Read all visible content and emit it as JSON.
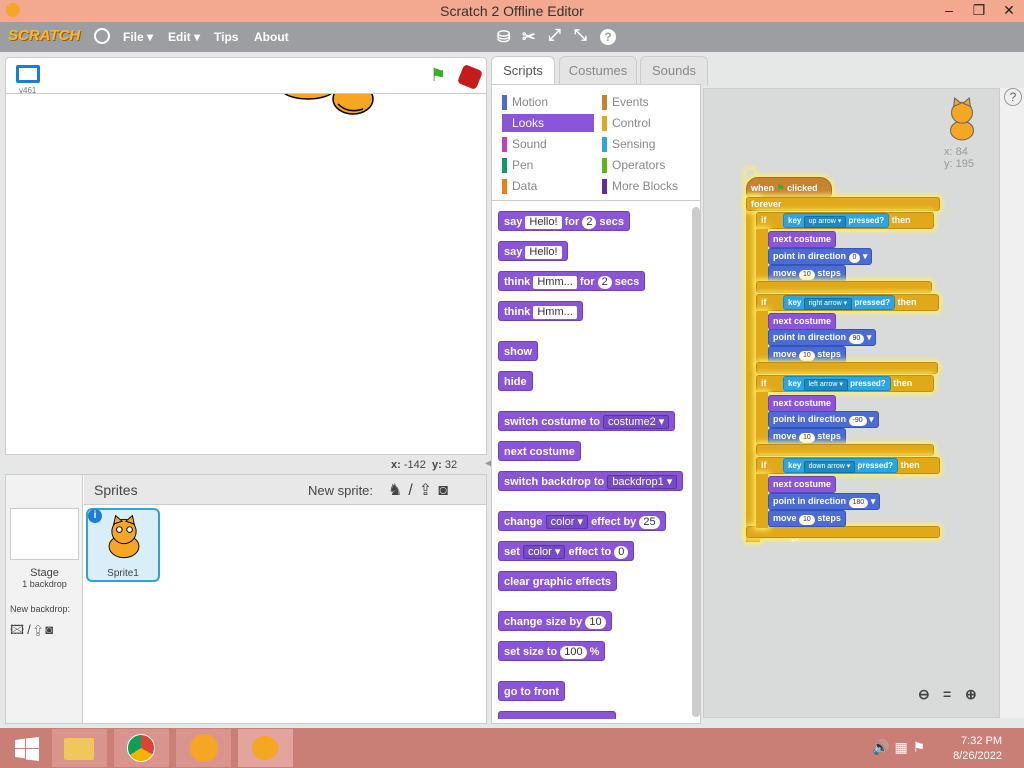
{
  "window": {
    "title": "Scratch 2 Offline Editor"
  },
  "menu": {
    "logo": "SCRATCH",
    "file": "File ▾",
    "edit": "Edit ▾",
    "tips": "Tips",
    "about": "About"
  },
  "stage": {
    "version": "v461",
    "mouse_x_label": "x:",
    "mouse_x": "-142",
    "mouse_y_label": "y:",
    "mouse_y": "32"
  },
  "sprites_pane": {
    "title": "Sprites",
    "new_sprite": "New sprite:",
    "stage_label": "Stage",
    "stage_backdrops": "1 backdrop",
    "new_backdrop": "New backdrop:",
    "sprite_name": "Sprite1"
  },
  "tabs": [
    "Scripts",
    "Costumes",
    "Sounds"
  ],
  "categories": [
    {
      "label": "Motion",
      "color": "#4a6cd4"
    },
    {
      "label": "Events",
      "color": "#c88330"
    },
    {
      "label": "Looks",
      "color": "#8a55d7"
    },
    {
      "label": "Control",
      "color": "#e1a91a"
    },
    {
      "label": "Sound",
      "color": "#bb42c3"
    },
    {
      "label": "Sensing",
      "color": "#2ca5e2"
    },
    {
      "label": "Pen",
      "color": "#0e9a6c"
    },
    {
      "label": "Operators",
      "color": "#5cb712"
    },
    {
      "label": "Data",
      "color": "#ee7d16"
    },
    {
      "label": "More Blocks",
      "color": "#632d99"
    }
  ],
  "palette": {
    "say_for": {
      "a": "say",
      "msg": "Hello!",
      "b": "for",
      "n": "2",
      "c": "secs"
    },
    "say": {
      "a": "say",
      "msg": "Hello!"
    },
    "think_for": {
      "a": "think",
      "msg": "Hmm...",
      "b": "for",
      "n": "2",
      "c": "secs"
    },
    "think": {
      "a": "think",
      "msg": "Hmm..."
    },
    "show": "show",
    "hide": "hide",
    "switch_costume": {
      "a": "switch costume to",
      "v": "costume2"
    },
    "next_costume": "next costume",
    "switch_backdrop": {
      "a": "switch backdrop to",
      "v": "backdrop1"
    },
    "change_effect": {
      "a": "change",
      "v": "color",
      "b": "effect by",
      "n": "25"
    },
    "set_effect": {
      "a": "set",
      "v": "color",
      "b": "effect to",
      "n": "0"
    },
    "clear_effects": "clear graphic effects",
    "change_size": {
      "a": "change size by",
      "n": "10"
    },
    "set_size": {
      "a": "set size to",
      "n": "100",
      "b": "%"
    },
    "go_front": "go to front"
  },
  "script": {
    "hat": {
      "a": "when",
      "b": "clicked"
    },
    "forever": "forever",
    "if_label": "if",
    "key_label": "key",
    "pressed_label": "pressed?",
    "then_label": "then",
    "next_costume": "next costume",
    "point": "point in direction",
    "move": "move",
    "steps": "steps",
    "move_n": "10",
    "ifs": [
      {
        "key": "up arrow",
        "dir": "0"
      },
      {
        "key": "right arrow",
        "dir": "90"
      },
      {
        "key": "left arrow",
        "dir": "-90"
      },
      {
        "key": "down arrow",
        "dir": "180"
      }
    ],
    "sprite_x_label": "x:",
    "sprite_x": "84",
    "sprite_y_label": "y:",
    "sprite_y": "195"
  },
  "taskbar": {
    "time": "7:32 PM",
    "date": "8/26/2022"
  }
}
